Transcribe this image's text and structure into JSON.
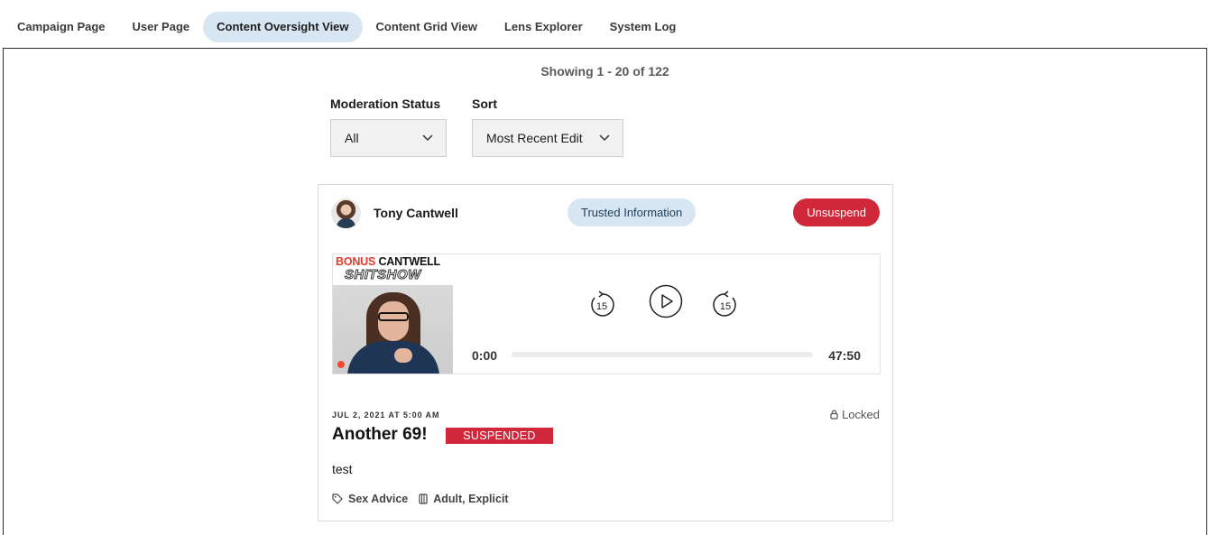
{
  "tabs": [
    {
      "label": "Campaign Page",
      "active": false
    },
    {
      "label": "User Page",
      "active": false
    },
    {
      "label": "Content Oversight View",
      "active": true
    },
    {
      "label": "Content Grid View",
      "active": false
    },
    {
      "label": "Lens Explorer",
      "active": false
    },
    {
      "label": "System Log",
      "active": false
    }
  ],
  "results": {
    "showing": "Showing 1 - 20 of 122"
  },
  "filters": {
    "moderation_status": {
      "label": "Moderation Status",
      "value": "All"
    },
    "sort": {
      "label": "Sort",
      "value": "Most Recent Edit"
    }
  },
  "post": {
    "author": "Tony Cantwell",
    "trust_label": "Trusted Information",
    "action_label": "Unsuspend",
    "thumbnail": {
      "title_red": "BONUS",
      "title_black": "CANTWELL",
      "subtitle": "SHITSHOW"
    },
    "player": {
      "current_time": "0:00",
      "duration": "47:50",
      "skip_seconds": "15",
      "progress": 0
    },
    "date": "JUL 2, 2021 AT 5:00 AM",
    "lock_status": "Locked",
    "title": "Another 69!",
    "status_badge": "SUSPENDED",
    "body": "test",
    "tags": [
      {
        "icon": "tag-icon",
        "label": "Sex Advice"
      },
      {
        "icon": "content-rating-icon",
        "label": "Adult, Explicit"
      }
    ]
  },
  "colors": {
    "accent_blue": "#d7e6f2",
    "danger_red": "#d0273a",
    "thumb_red": "#e23a2e"
  }
}
